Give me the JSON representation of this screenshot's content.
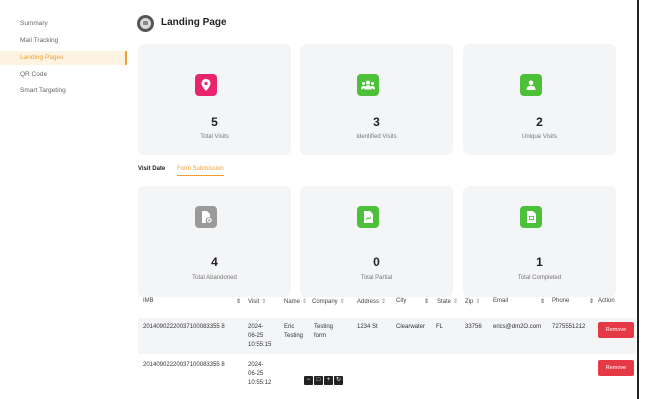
{
  "sidebar": {
    "items": [
      {
        "label": "Summary"
      },
      {
        "label": "Mail Tracking"
      },
      {
        "label": "Landing Pages"
      },
      {
        "label": "QR Code"
      },
      {
        "label": "Smart Targeting"
      }
    ],
    "active_index": 2
  },
  "header": {
    "title": "Landing Page"
  },
  "stats": {
    "total_visits": {
      "value": "5",
      "label": "Total Visits",
      "color": "#e8246e"
    },
    "identified_visits": {
      "value": "3",
      "label": "Identified Visits",
      "color": "#4cc038"
    },
    "unique_visits": {
      "value": "2",
      "label": "Unique Visits",
      "color": "#4cc038"
    }
  },
  "tabs": {
    "visit_date": "Visit Date",
    "form_submission": "Form Submission"
  },
  "form_stats": {
    "abandoned": {
      "value": "4",
      "label": "Total Abandoned",
      "color": "#9a9a9a"
    },
    "partial": {
      "value": "0",
      "label": "Total Partial",
      "color": "#4cc038"
    },
    "completed": {
      "value": "1",
      "label": "Total Completed",
      "color": "#4cc038"
    }
  },
  "table": {
    "columns": [
      "IMB",
      "Visit",
      "Name",
      "Company",
      "Address",
      "City",
      "State",
      "Zip",
      "Email",
      "Phone",
      "Action"
    ],
    "sort_glyph": "⇕",
    "rows": [
      {
        "imb": "20140902220037100083355 8",
        "visit_1": "2024-",
        "visit_2": "06-25",
        "visit_3": "10:55:15",
        "name_1": "Eric",
        "name_2": "Testing",
        "company_1": "Testing",
        "company_2": "form",
        "address": "1234 St",
        "city": "Clearwater",
        "state": "FL",
        "zip": "33756",
        "email": "erics@dm2O.com",
        "phone": "7275551212",
        "action": "Remove"
      },
      {
        "imb": "20140902220037100083355 8",
        "visit_1": "2024-",
        "visit_2": "06-25",
        "visit_3": "10:55:12",
        "action": "Remove"
      }
    ]
  },
  "toolbar": {
    "minus": "−",
    "square": "□",
    "plus": "+",
    "refresh": "↻"
  }
}
